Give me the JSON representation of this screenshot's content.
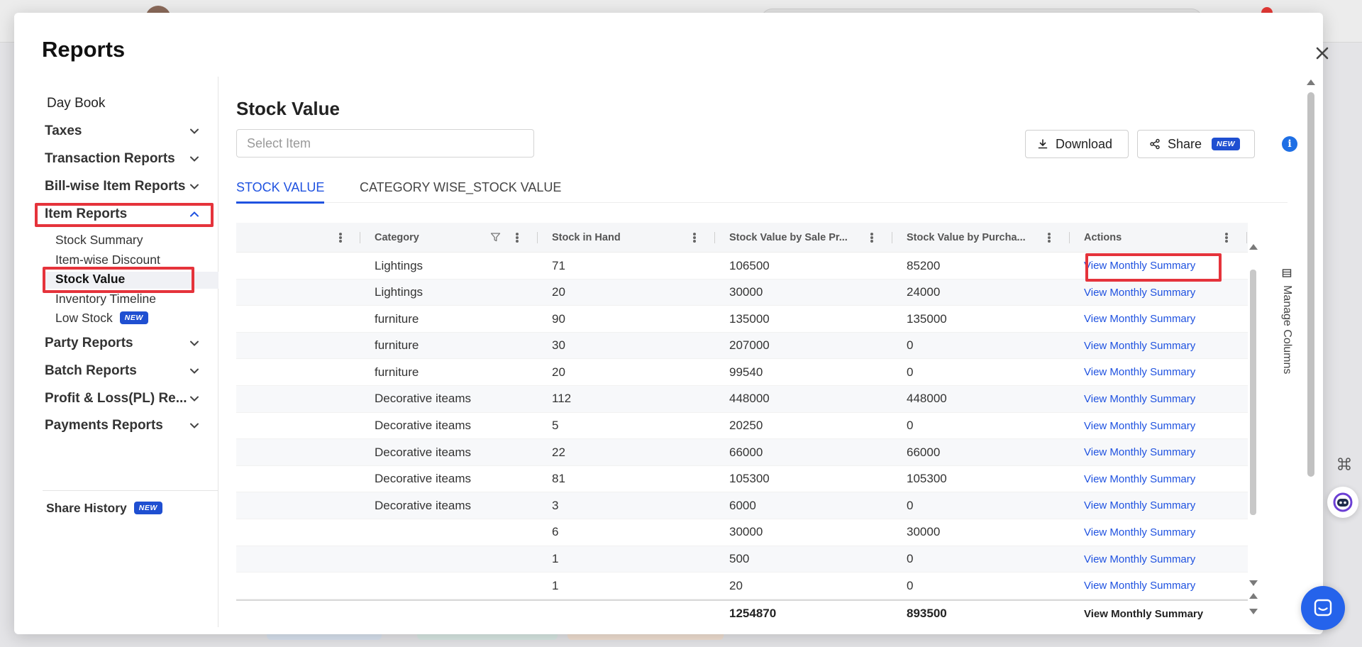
{
  "modal": {
    "title": "Reports"
  },
  "sidebar": {
    "day_book": "Day Book",
    "taxes": "Taxes",
    "transaction_reports": "Transaction Reports",
    "billwise_item_reports": "Bill-wise Item Reports",
    "item_reports": "Item Reports",
    "item_reports_sub": {
      "stock_summary": "Stock Summary",
      "itemwise_discount": "Item-wise Discount",
      "stock_value": "Stock Value",
      "inventory_timeline": "Inventory Timeline",
      "low_stock": "Low Stock"
    },
    "party_reports": "Party Reports",
    "batch_reports": "Batch Reports",
    "profit_loss": "Profit & Loss(PL) Re...",
    "payments_reports": "Payments Reports",
    "share_history": "Share History",
    "new_badge": "NEW"
  },
  "content": {
    "heading": "Stock Value",
    "select_placeholder": "Select Item",
    "download_label": "Download",
    "share_label": "Share",
    "share_badge": "NEW",
    "info": "i",
    "tabs": [
      "STOCK VALUE",
      "CATEGORY WISE_STOCK VALUE"
    ],
    "manage_columns": "Manage Columns"
  },
  "table": {
    "headers": {
      "category": "Category",
      "stock_in_hand": "Stock in Hand",
      "value_sale": "Stock Value by Sale Pr...",
      "value_purchase": "Stock Value by Purcha...",
      "actions": "Actions"
    },
    "rows": [
      {
        "category": "Lightings",
        "stock": "71",
        "sale": "106500",
        "purchase": "85200",
        "action": "View Monthly Summary"
      },
      {
        "category": "Lightings",
        "stock": "20",
        "sale": "30000",
        "purchase": "24000",
        "action": "View Monthly Summary"
      },
      {
        "category": "furniture",
        "stock": "90",
        "sale": "135000",
        "purchase": "135000",
        "action": "View Monthly Summary"
      },
      {
        "category": "furniture",
        "stock": "30",
        "sale": "207000",
        "purchase": "0",
        "action": "View Monthly Summary"
      },
      {
        "category": "furniture",
        "stock": "20",
        "sale": "99540",
        "purchase": "0",
        "action": "View Monthly Summary"
      },
      {
        "category": "Decorative iteams",
        "stock": "112",
        "sale": "448000",
        "purchase": "448000",
        "action": "View Monthly Summary"
      },
      {
        "category": "Decorative iteams",
        "stock": "5",
        "sale": "20250",
        "purchase": "0",
        "action": "View Monthly Summary"
      },
      {
        "category": "Decorative iteams",
        "stock": "22",
        "sale": "66000",
        "purchase": "66000",
        "action": "View Monthly Summary"
      },
      {
        "category": "Decorative iteams",
        "stock": "81",
        "sale": "105300",
        "purchase": "105300",
        "action": "View Monthly Summary"
      },
      {
        "category": "Decorative iteams",
        "stock": "3",
        "sale": "6000",
        "purchase": "0",
        "action": "View Monthly Summary"
      },
      {
        "category": "",
        "stock": "6",
        "sale": "30000",
        "purchase": "30000",
        "action": "View Monthly Summary"
      },
      {
        "category": "",
        "stock": "1",
        "sale": "500",
        "purchase": "0",
        "action": "View Monthly Summary"
      },
      {
        "category": "",
        "stock": "1",
        "sale": "20",
        "purchase": "0",
        "action": "View Monthly Summary"
      }
    ],
    "footer": {
      "sale_total": "1254870",
      "purchase_total": "893500",
      "action": "View Monthly Summary"
    }
  },
  "colors": {
    "accent": "#1f52e0",
    "highlight": "#e5333b",
    "badge": "#1f4fd1"
  }
}
